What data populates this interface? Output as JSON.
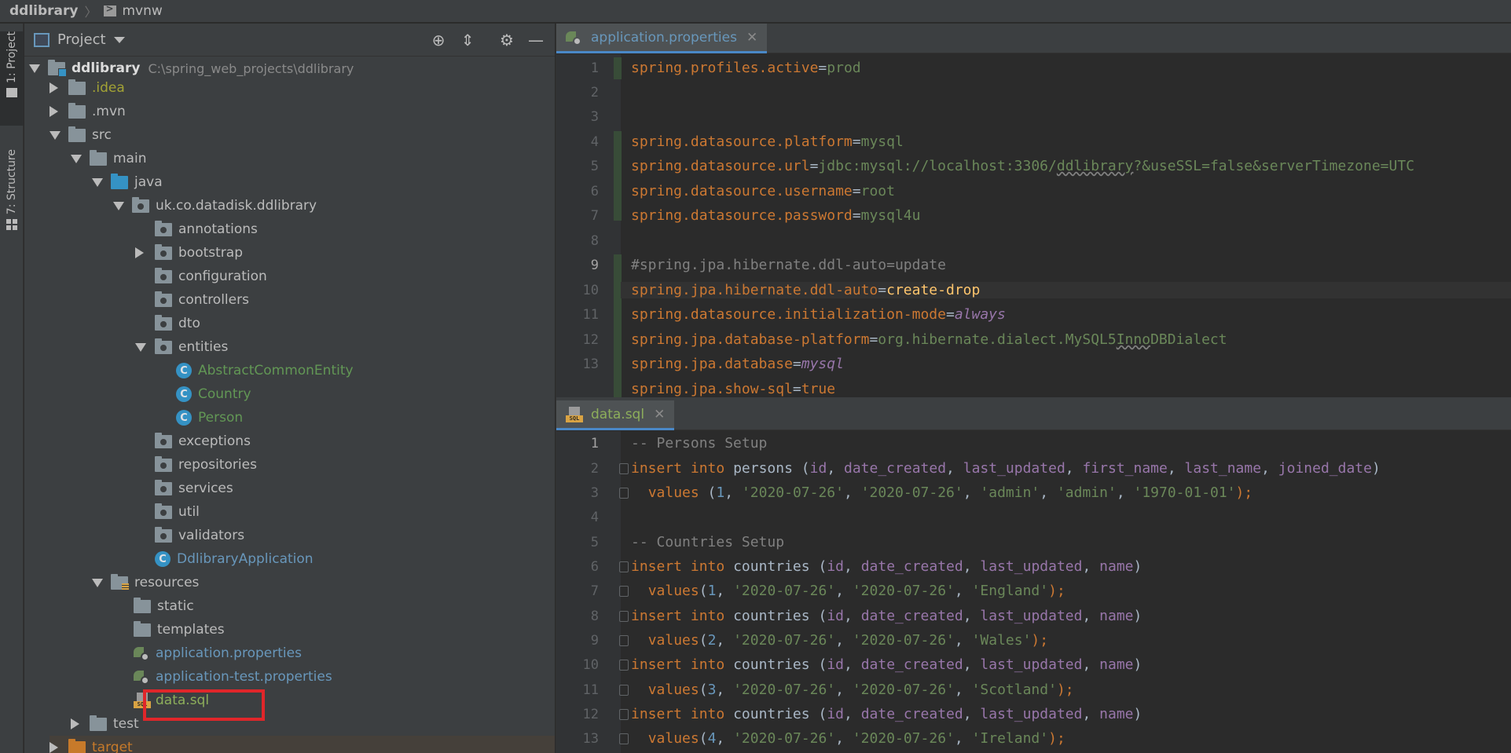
{
  "breadcrumb": {
    "root": "ddlibrary",
    "child": "mvnw"
  },
  "toolstrip": {
    "project_tab": "1: Project",
    "structure_tab": "7: Structure"
  },
  "project_panel": {
    "title": "Project",
    "tree": [
      {
        "label": "ddlibrary",
        "extra": "C:\\spring_web_projects\\ddlibrary"
      },
      {
        "label": ".idea"
      },
      {
        "label": ".mvn"
      },
      {
        "label": "src"
      },
      {
        "label": "main"
      },
      {
        "label": "java"
      },
      {
        "label": "uk.co.datadisk.ddlibrary"
      },
      {
        "label": "annotations"
      },
      {
        "label": "bootstrap"
      },
      {
        "label": "configuration"
      },
      {
        "label": "controllers"
      },
      {
        "label": "dto"
      },
      {
        "label": "entities"
      },
      {
        "label": "AbstractCommonEntity"
      },
      {
        "label": "Country"
      },
      {
        "label": "Person"
      },
      {
        "label": "exceptions"
      },
      {
        "label": "repositories"
      },
      {
        "label": "services"
      },
      {
        "label": "util"
      },
      {
        "label": "validators"
      },
      {
        "label": "DdlibraryApplication"
      },
      {
        "label": "resources"
      },
      {
        "label": "static"
      },
      {
        "label": "templates"
      },
      {
        "label": "application.properties"
      },
      {
        "label": "application-test.properties"
      },
      {
        "label": "data.sql"
      },
      {
        "label": "test"
      },
      {
        "label": "target"
      }
    ]
  },
  "editor_top": {
    "tab_label": "application.properties",
    "lines": [
      {
        "n": "1",
        "key": "spring.profiles.active",
        "val": "prod"
      },
      {
        "n": "2"
      },
      {
        "n": "3",
        "key": "spring.datasource.platform",
        "val": "mysql"
      },
      {
        "n": "4",
        "key": "spring.datasource.url",
        "val_a": "jdbc:mysql://localhost:3306/",
        "val_b": "ddlibrary",
        "val_c": "?&useSSL=false&serverTimezone=UTC"
      },
      {
        "n": "5",
        "key": "spring.datasource.username",
        "val": "root"
      },
      {
        "n": "6",
        "key": "spring.datasource.password",
        "val": "mysql4u"
      },
      {
        "n": "7"
      },
      {
        "n": "8",
        "comment": "#spring.jpa.hibernate.ddl-auto=update"
      },
      {
        "n": "9",
        "key": "spring.jpa.hibernate.ddl-auto",
        "val": "create-drop"
      },
      {
        "n": "10",
        "key": "spring.datasource.initialization-mode",
        "val": "always"
      },
      {
        "n": "11",
        "key": "spring.jpa.database-platform",
        "val_a": "org.hibernate.dialect.MySQL5",
        "val_b": "Inno",
        "val_c": "DBDialect"
      },
      {
        "n": "12",
        "key": "spring.jpa.database",
        "val": "mysql"
      },
      {
        "n": "13",
        "key": "spring.jpa.show-sql",
        "val": "true"
      }
    ]
  },
  "editor_bottom": {
    "tab_label": "data.sql",
    "numbers": [
      "1",
      "2",
      "3",
      "4",
      "5",
      "6",
      "7",
      "8",
      "9",
      "10",
      "11",
      "12",
      "13"
    ],
    "comment1": "-- Persons Setup",
    "comment2": "-- Countries Setup",
    "persons_cols": [
      "id",
      "date_created",
      "last_updated",
      "first_name",
      "last_name",
      "joined_date"
    ],
    "persons_vals": [
      "1",
      "'2020-07-26'",
      "'2020-07-26'",
      "'admin'",
      "'admin'",
      "'1970-01-01'"
    ],
    "countries_cols": [
      "id",
      "date_created",
      "last_updated",
      "name"
    ],
    "countries": [
      {
        "id": "1",
        "d1": "'2020-07-26'",
        "d2": "'2020-07-26'",
        "name": "'England'"
      },
      {
        "id": "2",
        "d1": "'2020-07-26'",
        "d2": "'2020-07-26'",
        "name": "'Wales'"
      },
      {
        "id": "3",
        "d1": "'2020-07-26'",
        "d2": "'2020-07-26'",
        "name": "'Scotland'"
      },
      {
        "id": "4",
        "d1": "'2020-07-26'",
        "d2": "'2020-07-26'",
        "name": "'Ireland'"
      }
    ],
    "kw_insert": "insert",
    "kw_into": "into",
    "kw_values": "values",
    "tbl_persons": "persons",
    "tbl_countries": "countries"
  }
}
